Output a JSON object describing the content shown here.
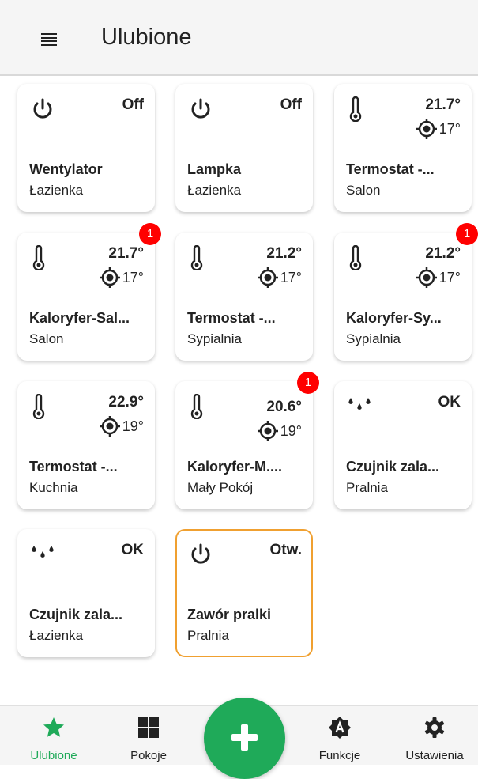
{
  "header": {
    "title": "Ulubione",
    "menu_icon": "hamburger-menu-icon"
  },
  "cards": [
    {
      "name": "Wentylator",
      "room": "Łazienka",
      "icon": "power-icon",
      "status": "Off"
    },
    {
      "name": "Lampka",
      "room": "Łazienka",
      "icon": "power-icon",
      "status": "Off"
    },
    {
      "name": "Termostat -...",
      "room": "Salon",
      "icon": "thermometer-icon",
      "temp": "21.7°",
      "target": "17°"
    },
    {
      "name": "Kaloryfer-Sal...",
      "room": "Salon",
      "icon": "thermometer-icon",
      "temp": "21.7°",
      "target": "17°",
      "badge": "1"
    },
    {
      "name": "Termostat -...",
      "room": "Sypialnia",
      "icon": "thermometer-icon",
      "temp": "21.2°",
      "target": "17°"
    },
    {
      "name": "Kaloryfer-Sy...",
      "room": "Sypialnia",
      "icon": "thermometer-icon",
      "temp": "21.2°",
      "target": "17°",
      "badge": "1"
    },
    {
      "name": "Termostat -...",
      "room": "Kuchnia",
      "icon": "thermometer-icon",
      "temp": "22.9°",
      "target": "19°"
    },
    {
      "name": "Kaloryfer-M....",
      "room": "Mały Pokój",
      "icon": "thermometer-icon",
      "temp": "20.6°",
      "target": "19°",
      "badge": "1"
    },
    {
      "name": "Czujnik zala...",
      "room": "Pralnia",
      "icon": "water-drops-icon",
      "status": "OK"
    },
    {
      "name": "Czujnik zala...",
      "room": "Łazienka",
      "icon": "water-drops-icon",
      "status": "OK"
    },
    {
      "name": "Zawór pralki",
      "room": "Pralnia",
      "icon": "power-icon",
      "status": "Otw.",
      "selected": true
    }
  ],
  "nav": {
    "items": [
      {
        "label": "Ulubione",
        "icon": "star-icon",
        "active": true
      },
      {
        "label": "Pokoje",
        "icon": "grid-icon"
      },
      {
        "label": "Funkcje",
        "icon": "functions-icon"
      },
      {
        "label": "Ustawienia",
        "icon": "gear-icon"
      }
    ],
    "fab_icon": "plus-icon"
  },
  "colors": {
    "accent": "#1faa59",
    "badge": "#ff0000",
    "selected_border": "#f0a030"
  }
}
